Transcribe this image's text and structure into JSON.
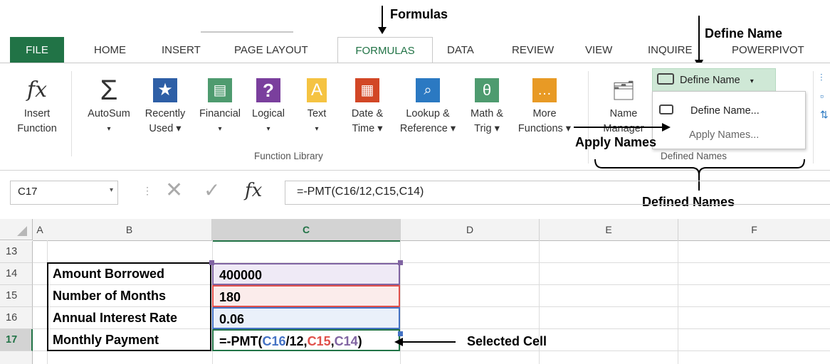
{
  "callouts": {
    "formulas": "Formulas",
    "define_name": "Define Name",
    "apply_names": "Apply Names",
    "defined_names": "Defined Names",
    "selected_cell": "Selected Cell"
  },
  "tabs": [
    "FILE",
    "HOME",
    "INSERT",
    "PAGE LAYOUT",
    "FORMULAS",
    "DATA",
    "REVIEW",
    "VIEW",
    "INQUIRE",
    "POWERPIVOT"
  ],
  "ribbon": {
    "commands": [
      {
        "line1": "Insert",
        "line2": "Function"
      },
      {
        "line1": "AutoSum",
        "line2": "▾"
      },
      {
        "line1": "Recently",
        "line2": "Used ▾"
      },
      {
        "line1": "Financial",
        "line2": "▾"
      },
      {
        "line1": "Logical",
        "line2": "▾"
      },
      {
        "line1": "Text",
        "line2": "▾"
      },
      {
        "line1": "Date &",
        "line2": "Time ▾"
      },
      {
        "line1": "Lookup &",
        "line2": "Reference ▾"
      },
      {
        "line1": "Math &",
        "line2": "Trig ▾"
      },
      {
        "line1": "More",
        "line2": "Functions ▾"
      }
    ],
    "function_library_label": "Function Library",
    "name_manager": {
      "line1": "Name",
      "line2": "Manager"
    },
    "define_name_button": "Define Name",
    "menu": {
      "define_name": "Define Name...",
      "apply_names": "Apply Names..."
    },
    "defined_names_label": "Defined Names"
  },
  "formula_bar": {
    "name_box": "C17",
    "formula": "=-PMT(C16/12,C15,C14)"
  },
  "grid": {
    "columns": [
      "A",
      "B",
      "C",
      "D",
      "E",
      "F"
    ],
    "rows": [
      "13",
      "14",
      "15",
      "16",
      "17"
    ],
    "labels": [
      "Amount Borrowed",
      "Number of Months",
      "Annual Interest Rate",
      "Monthly Payment"
    ],
    "values": [
      "400000",
      "180",
      "0.06"
    ],
    "formula_parts": {
      "prefix": "=-PMT(",
      "ref1": "C16",
      "mid1": "/12,",
      "ref2": "C15",
      "mid2": ",",
      "ref3": "C14",
      "suffix": ")"
    }
  },
  "colors": {
    "excel_green": "#217346",
    "ref_blue": "#4472c4",
    "ref_red": "#e0504a",
    "ref_purple": "#8064a2",
    "define_highlight": "#cfe8d6"
  }
}
